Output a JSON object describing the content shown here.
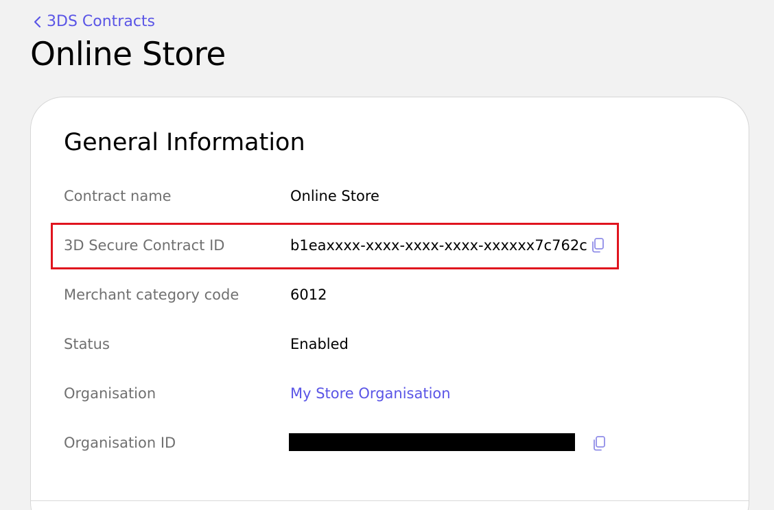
{
  "breadcrumb": {
    "label": "3DS Contracts"
  },
  "page": {
    "title": "Online Store"
  },
  "card": {
    "title": "General Information",
    "rows": [
      {
        "label": "Contract name",
        "value": "Online Store"
      },
      {
        "label": "3D Secure Contract ID",
        "value": "b1eaxxxx-xxxx-xxxx-xxxx-xxxxxx7c762c",
        "copyable": true
      },
      {
        "label": "Merchant category code",
        "value": "6012"
      },
      {
        "label": "Status",
        "value": "Enabled"
      },
      {
        "label": "Organisation",
        "value": "My Store Organisation",
        "link": true
      },
      {
        "label": "Organisation ID",
        "value": "",
        "redacted": true,
        "copyable": true
      }
    ]
  },
  "colors": {
    "accent": "#5a55e6",
    "highlight": "#e0141e",
    "label": "#707070",
    "background": "#f2f2f2"
  },
  "icons": [
    "chevron-left-icon",
    "copy-icon"
  ]
}
